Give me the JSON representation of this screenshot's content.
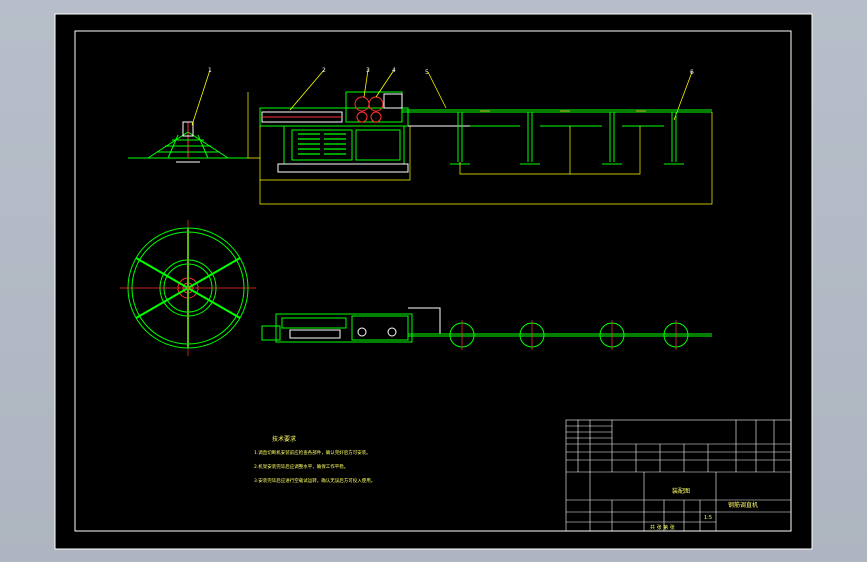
{
  "callouts": [
    "1",
    "2",
    "3",
    "4",
    "5",
    "6"
  ],
  "notes": {
    "heading": "技术要求",
    "lines": [
      "1.调直切断机安装前应检查各部件，确认完好后方可安装。",
      "2.机架安装完毕后应调整水平，确保工作平稳。",
      "3.安装完毕后应进行空载试运转，确认无误后方可投入使用。"
    ]
  },
  "title_block": {
    "drawing_title": "钢筋调直机",
    "assembly": "装配图",
    "scale": "1:5",
    "sheet": "共 张 第 张"
  }
}
